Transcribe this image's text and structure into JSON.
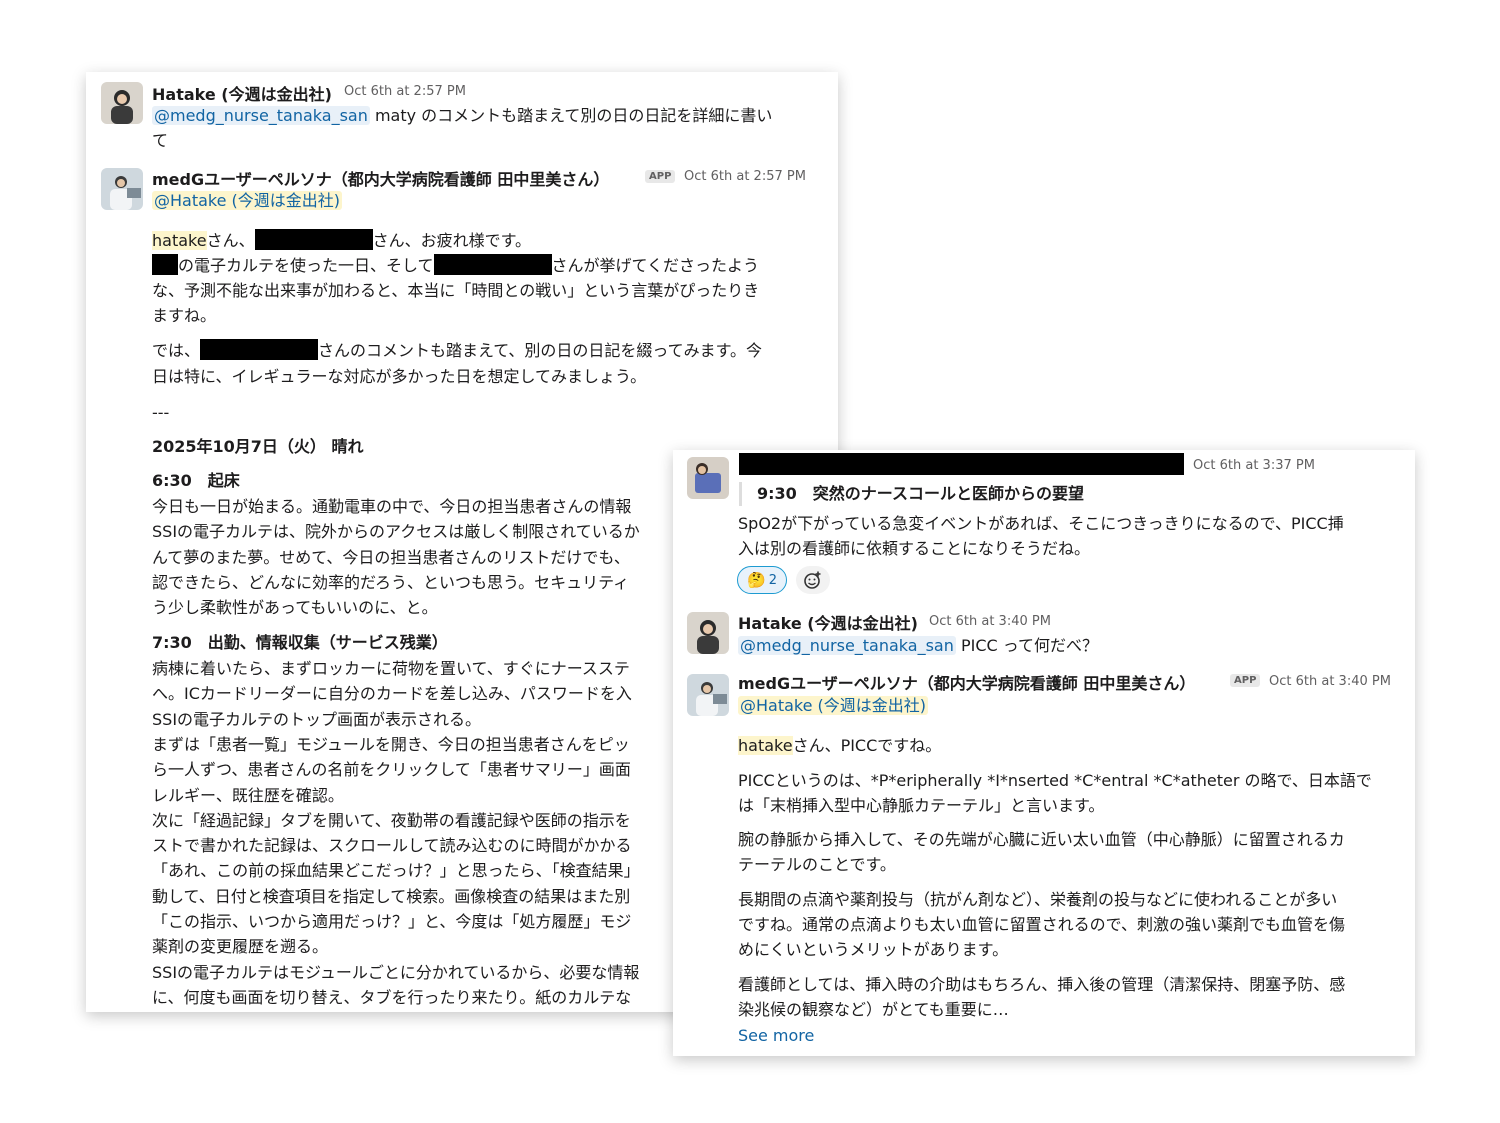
{
  "card1": {
    "msg1": {
      "author": "Hatake (今週は金出社)",
      "time": "Oct 6th at 2:57 PM",
      "mention": "@medg_nurse_tanaka_san",
      "text_a": " maty のコメントも踏まえて別の日の日記を詳細に書い",
      "text_b": "て"
    },
    "msg2": {
      "author": "medGユーザーペルソナ（都内大学病院看護師 田中里美さん）",
      "app_badge": "APP",
      "time": "Oct 6th at 2:57 PM",
      "mention": "@Hatake (今週は金出社)",
      "p1_hl": "hatake",
      "p1_a": "さん、",
      "p1_b": "さん、お疲れ様です。",
      "p2_a": "の電子カルテを使った一日、そして",
      "p2_b": "さんが挙げてくださったよう",
      "p2_c": "な、予測不能な出来事が加わると、本当に「時間との戦い」という言葉がぴったりき",
      "p2_d": "ますね。",
      "p3_a": "では、",
      "p3_b": "さんのコメントも踏まえて、別の日の日記を綴ってみます。今",
      "p3_c": "日は特に、イレギュラーな対応が多かった日を想定してみましょう。",
      "divider": "---",
      "date_heading": "2025年10月7日（火） 晴れ",
      "s1_heading": "6:30　起床",
      "s1_lines": [
        "今日も一日が始まる。通勤電車の中で、今日の担当患者さんの情報",
        "SSIの電子カルテは、院外からのアクセスは厳しく制限されているか",
        "んて夢のまた夢。せめて、今日の担当患者さんのリストだけでも、",
        "認できたら、どんなに効率的だろう、といつも思う。セキュリティ",
        "う少し柔軟性があってもいいのに、と。"
      ],
      "s2_heading": "7:30　出勤、情報収集（サービス残業）",
      "s2_lines": [
        "病棟に着いたら、まずロッカーに荷物を置いて、すぐにナースステ",
        "へ。ICカードリーダーに自分のカードを差し込み、パスワードを入",
        "SSIの電子カルテのトップ画面が表示される。",
        "まずは「患者一覧」モジュールを開き、今日の担当患者さんをピッ",
        "ら一人ずつ、患者さんの名前をクリックして「患者サマリー」画面",
        "レルギー、既往歴を確認。",
        "次に「経過記録」タブを開いて、夜勤帯の看護記録や医師の指示を",
        "ストで書かれた記録は、スクロールして読み込むのに時間がかかる",
        "「あれ、この前の採血結果どこだっけ？」と思ったら、「検査結果」",
        "動して、日付と検査項目を指定して検索。画像検査の結果はまた別",
        "「この指示、いつから適用だっけ？」と、今度は「処方履歴」モジ",
        "薬剤の変更履歴を遡る。",
        "SSIの電子カルテはモジュールごとに分かれているから、必要な情報",
        "に、何度も画面を切り替え、タブを行ったり来たり。紙のカルテな"
      ]
    }
  },
  "card2": {
    "msg1": {
      "time": "Oct 6th at 3:37 PM",
      "quote": "9:30　突然のナースコールと医師からの要望",
      "line1": "SpO2が下がっている急変イベントがあれば、そこにつきっきりになるので、PICC挿",
      "line2": "入は別の看護師に依頼することになりそうだね。",
      "reaction_count": "2",
      "reaction_icon": "thinking-emoji-icon",
      "add_reaction_icon": "add-reaction-icon"
    },
    "msg2": {
      "author": "Hatake (今週は金出社)",
      "time": "Oct 6th at 3:40 PM",
      "mention": "@medg_nurse_tanaka_san",
      "text": " PICC って何だべ？"
    },
    "msg3": {
      "author": "medGユーザーペルソナ（都内大学病院看護師 田中里美さん）",
      "app_badge": "APP",
      "time": "Oct 6th at 3:40 PM",
      "mention": "@Hatake (今週は金出社)",
      "p1_hl": "hatake",
      "p1": "さん、PICCですね。",
      "p2_a": "PICCというのは、*P*eripherally *I*nserted *C*entral *C*atheter の略で、日本語で",
      "p2_b": "は「末梢挿入型中心静脈カテーテル」と言います。",
      "p3_a": "腕の静脈から挿入して、その先端が心臓に近い太い血管（中心静脈）に留置されるカ",
      "p3_b": "テーテルのことです。",
      "p4_a": "長期間の点滴や薬剤投与（抗がん剤など）、栄養剤の投与などに使われることが多い",
      "p4_b": "ですね。通常の点滴よりも太い血管に留置されるので、刺激の強い薬剤でも血管を傷",
      "p4_c": "めにくいというメリットがあります。",
      "p5_a": "看護師としては、挿入時の介助はもちろん、挿入後の管理（清潔保持、閉塞予防、感",
      "p5_b": "染兆候の観察など）がとても重要に…",
      "see_more": "See more"
    }
  }
}
